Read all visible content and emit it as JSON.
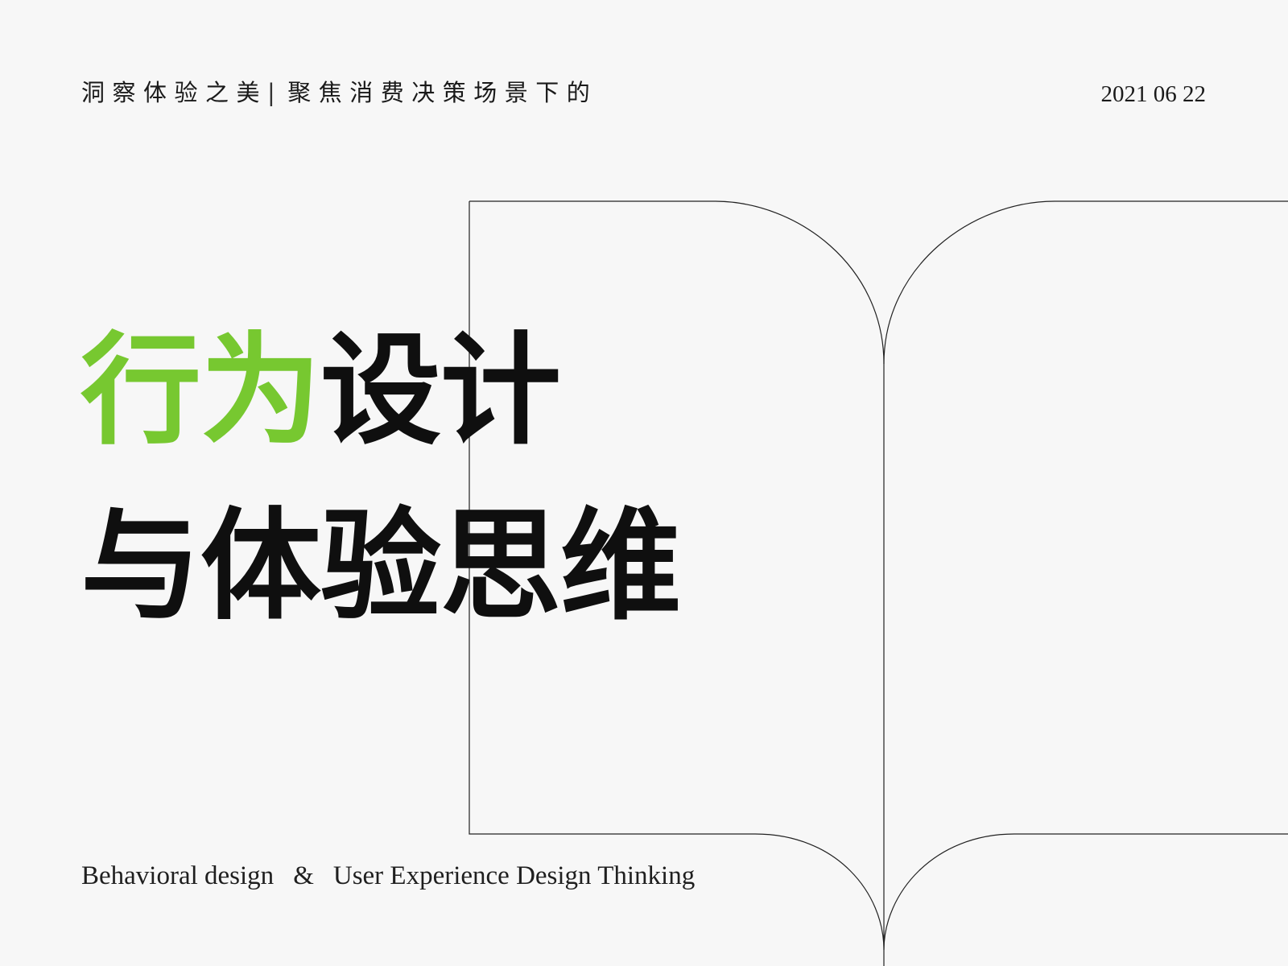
{
  "header": {
    "tagline_left": "洞察体验之美",
    "tagline_separator": "|",
    "tagline_right": "聚焦消费决策场景下的",
    "date": "2021 06 22"
  },
  "title": {
    "line1_accent": "行为",
    "line1_rest": "设计",
    "line2": "与体验思维"
  },
  "subtitle": {
    "left": "Behavioral design",
    "amp": "&",
    "right": "User Experience Design Thinking"
  },
  "colors": {
    "background": "#f7f7f7",
    "accent": "#77c830",
    "text": "#111111",
    "line": "#222222"
  }
}
